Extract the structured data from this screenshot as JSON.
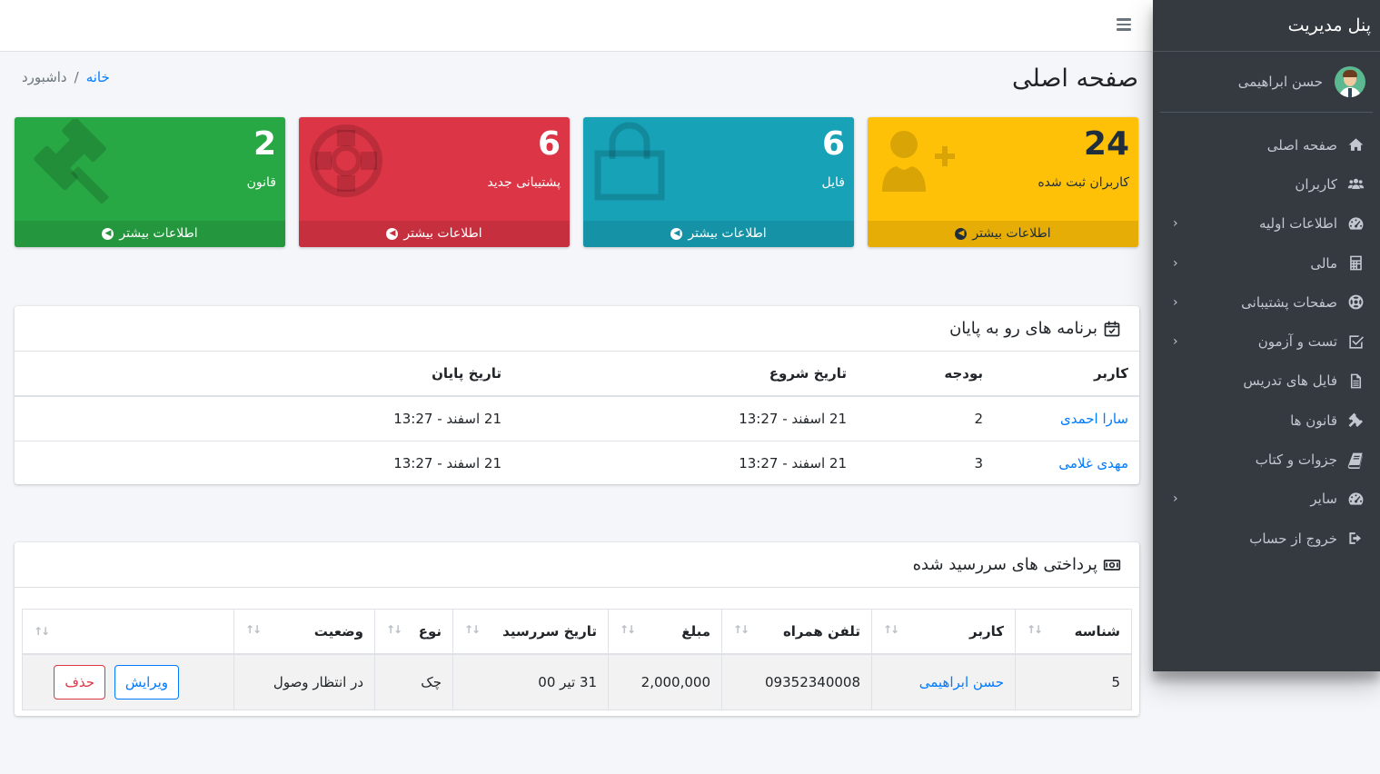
{
  "sidebar": {
    "brand": "پنل مدیریت",
    "user_name": "حسن ابراهیمی",
    "items": [
      {
        "label": "صفحه اصلی",
        "icon": "home-icon",
        "arrow": false
      },
      {
        "label": "کاربران",
        "icon": "users-icon",
        "arrow": false
      },
      {
        "label": "اطلاعات اولیه",
        "icon": "dashboard-icon",
        "arrow": true
      },
      {
        "label": "مالی",
        "icon": "calculator-icon",
        "arrow": true
      },
      {
        "label": "صفحات پشتیبانی",
        "icon": "support-icon",
        "arrow": true
      },
      {
        "label": "تست و آزمون",
        "icon": "check-square-icon",
        "arrow": true
      },
      {
        "label": "فایل های تدریس",
        "icon": "file-icon",
        "arrow": false
      },
      {
        "label": "قانون ها",
        "icon": "gavel-icon",
        "arrow": false
      },
      {
        "label": "جزوات و کتاب",
        "icon": "book-icon",
        "arrow": false
      },
      {
        "label": "سایر",
        "icon": "dashboard-icon",
        "arrow": true
      },
      {
        "label": "خروج از حساب",
        "icon": "sign-out-icon",
        "arrow": false
      }
    ]
  },
  "header": {
    "page_title": "صفحه اصلی",
    "breadcrumb_home": "خانه",
    "breadcrumb_sep": "/",
    "breadcrumb_current": "داشبورد"
  },
  "boxes": [
    {
      "value": "24",
      "label": "کاربران ثبت شده",
      "more": "اطلاعات بیشتر",
      "icon": "user-plus-icon",
      "color": "#ffc107"
    },
    {
      "value": "6",
      "label": "فایل",
      "more": "اطلاعات بیشتر",
      "icon": "shopping-bag-icon",
      "color": "#17a2b8"
    },
    {
      "value": "6",
      "label": "پشتیبانی جدید",
      "more": "اطلاعات بیشتر",
      "icon": "life-ring-icon",
      "color": "#dc3545"
    },
    {
      "value": "2",
      "label": "قانون",
      "more": "اطلاعات بیشتر",
      "icon": "gavel-icon",
      "color": "#28a745"
    }
  ],
  "programs": {
    "title": "برنامه های رو به پایان",
    "columns": [
      "کاربر",
      "بودجه",
      "تاریخ شروع",
      "تاریخ پایان"
    ],
    "rows": [
      {
        "user": "سارا احمدی",
        "budget": "2",
        "start": "21 اسفند - 13:27",
        "end": "21 اسفند - 13:27"
      },
      {
        "user": "مهدی غلامی",
        "budget": "3",
        "start": "21 اسفند - 13:27",
        "end": "21 اسفند - 13:27"
      }
    ]
  },
  "payments": {
    "title": "پرداختی های سررسید شده",
    "columns": [
      "شناسه",
      "کاربر",
      "تلفن همراه",
      "مبلغ",
      "تاریخ سررسید",
      "نوع",
      "وضعیت",
      ""
    ],
    "rows": [
      {
        "id": "5",
        "user": "حسن ابراهیمی",
        "phone": "09352340008",
        "amount": "2,000,000",
        "due": "31 تیر 00",
        "type": "چک",
        "status": "در انتظار وصول",
        "edit": "ویرایش",
        "delete": "حذف"
      }
    ]
  }
}
